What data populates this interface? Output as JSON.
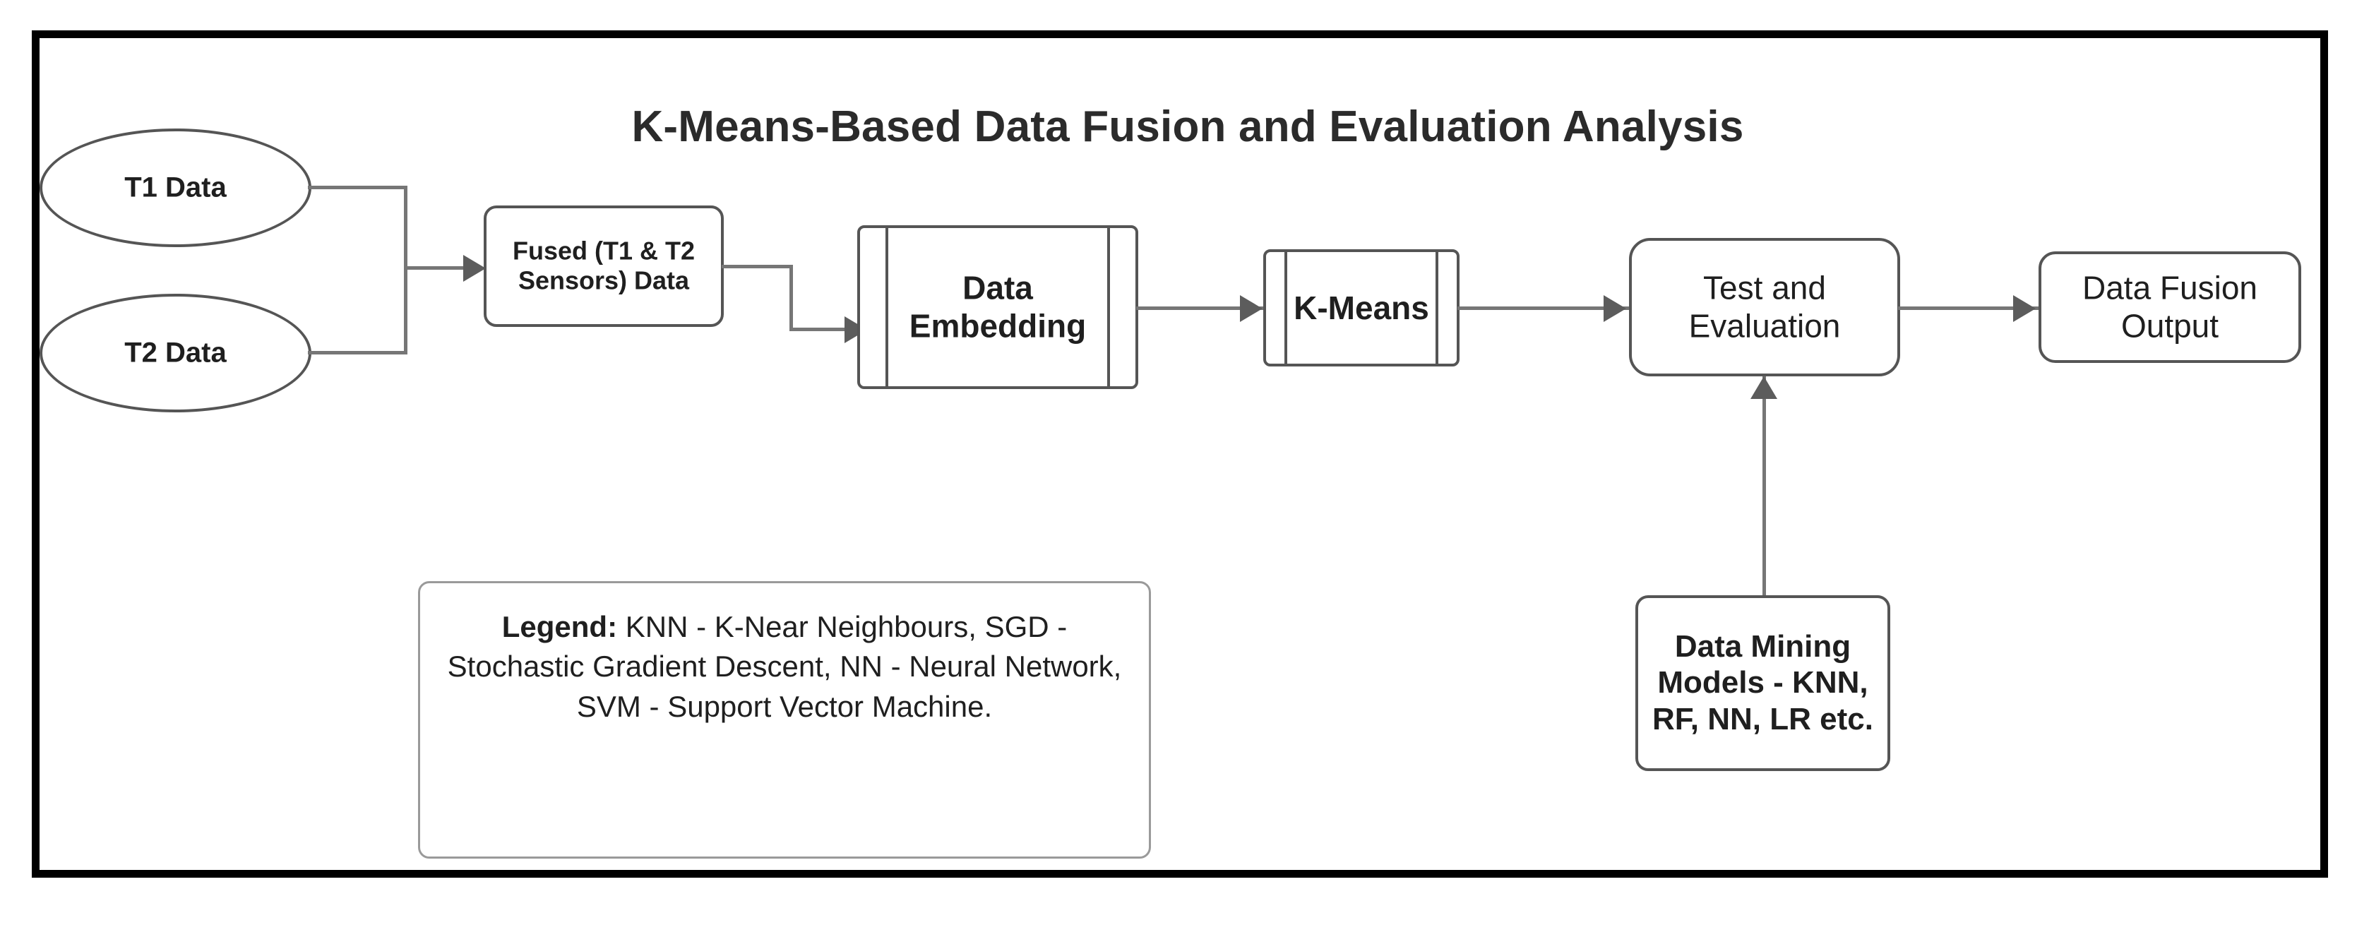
{
  "diagram": {
    "title": "K-Means-Based Data Fusion and Evaluation Analysis",
    "nodes": {
      "t1": {
        "label": "T1 Data",
        "shape": "ellipse"
      },
      "t2": {
        "label": "T2 Data",
        "shape": "ellipse"
      },
      "fused": {
        "line1": "Fused  (T1 & T2",
        "line2": "Sensors) Data",
        "shape": "rounded-rectangle"
      },
      "embedding": {
        "line1": "Data",
        "line2": "Embedding",
        "shape": "predefined-process"
      },
      "kmeans": {
        "label": "K-Means",
        "shape": "predefined-process"
      },
      "test_eval": {
        "line1": "Test and",
        "line2": "Evaluation",
        "shape": "rounded-rectangle"
      },
      "output": {
        "line1": "Data Fusion",
        "line2": "Output",
        "shape": "rounded-rectangle"
      },
      "data_mining": {
        "line1": "Data Mining",
        "line2": "Models - KNN,",
        "line3": "RF, NN, LR etc.",
        "shape": "rounded-rectangle"
      }
    },
    "legend": {
      "label": "Legend:",
      "text": " KNN - K-Near Neighbours, SGD - Stochastic Gradient Descent, NN - Neural Network, SVM - Support Vector Machine."
    },
    "colors": {
      "frame": "#000000",
      "node_stroke": "#555555",
      "connector": "#767676",
      "arrowhead": "#5c5c5c",
      "title_text": "#2b2b2b",
      "node_text": "#1f1f1f",
      "legend_stroke": "#9a9a9a",
      "background": "#ffffff"
    }
  }
}
